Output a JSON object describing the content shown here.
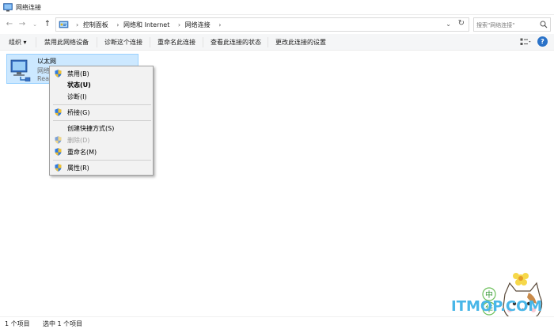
{
  "window": {
    "title": "网络连接"
  },
  "navigation": {
    "back_icon": "arrow-left-icon",
    "forward_icon": "arrow-right-icon",
    "recent_icon": "chevron-down-icon",
    "up_icon": "arrow-up-icon"
  },
  "address_bar": {
    "crumbs": [
      "控制面板",
      "网络和 Internet",
      "网络连接"
    ],
    "separator": "›",
    "dropdown_glyph": "⌄",
    "refresh_glyph": "↻"
  },
  "search": {
    "placeholder": "搜索\"网络连接\""
  },
  "command_bar": {
    "organize": "组织 ▾",
    "disable_device": "禁用此网络设备",
    "diagnose": "诊断这个连接",
    "rename": "重命名此连接",
    "view_status": "查看此连接的状态",
    "change_settings": "更改此连接的设置",
    "help_glyph": "?"
  },
  "connection": {
    "name": "以太网",
    "status_line": "网络",
    "device_line": "Rea"
  },
  "context_menu": {
    "items": [
      {
        "label": "禁用(B)",
        "shield": true
      },
      {
        "label": "状态(U)",
        "bold": true
      },
      {
        "label": "诊断(I)"
      },
      {
        "label": "桥接(G)",
        "shield": true
      },
      {
        "label": "创建快捷方式(S)"
      },
      {
        "label": "删除(D)",
        "shield": true,
        "disabled": true
      },
      {
        "label": "重命名(M)",
        "shield": true
      },
      {
        "label": "属性(R)",
        "shield": true
      }
    ]
  },
  "status_bar": {
    "item_count": "1 个项目",
    "selected": "选中 1 个项目"
  },
  "watermark": {
    "text": "ITMOP.COM",
    "chars": [
      "中",
      "华"
    ]
  },
  "colors": {
    "selection": "#cce8ff",
    "accent_blue": "#2a72c8",
    "watermark_blue": "#48b6e8",
    "shield_blue": "#1f5fbf",
    "shield_yellow": "#f2c230"
  }
}
